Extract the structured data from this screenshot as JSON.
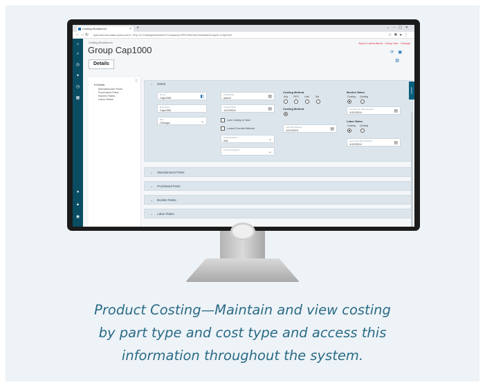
{
  "browser": {
    "tab_title": "Costing Workbench",
    "url": "epicorsb.test.saas.epicor.com/.../Erp.UI.CostingWorkbench?Company=EPIC06&Tab=Details&GroupID=Cap1000"
  },
  "app": {
    "breadcrumb": "Costing Workbench",
    "title": "Group Cap1000",
    "alert": "Epicor Latest Alerts · Group Info · Change",
    "details_button": "Details",
    "side_tab": "Actions"
  },
  "tree": {
    "root": "Details",
    "items": [
      "Manufactured Parts",
      "Purchased Parts",
      "Burden Rates",
      "Labor Rates"
    ]
  },
  "detail": {
    "header": "Detail",
    "group": {
      "label": "Group",
      "value": "Cap1000"
    },
    "description": {
      "label": "Description",
      "value": "Cap1000"
    },
    "site": {
      "label": "Site",
      "value": "Chicago"
    },
    "created_by": {
      "label": "Created By",
      "value": "epicor"
    },
    "created_date": {
      "label": "Created Date",
      "value": "1/12/2024"
    },
    "costing_method_title": "Costing Method",
    "costing_methods": [
      "Avg",
      "FIFO",
      "Last",
      "Std"
    ],
    "costing_method2_title": "Costing Method",
    "check_allow_settings": "Lock Costing on Save",
    "check_allow_override": "Locked Override Methods",
    "default_method": {
      "label": "Default Method",
      "value": "Std"
    },
    "last_method": {
      "label": "Last Part Refresh",
      "value": "1/12/2024"
    },
    "burden_title": "Burden Rates",
    "burden_options": [
      "Costing",
      "Quoting"
    ],
    "burden_date": {
      "label": "Last Burden Rate Refresh",
      "value": "1/12/2024"
    },
    "labor_title": "Labor Rates",
    "labor_options": [
      "Costing",
      "Quoting"
    ],
    "labor_date": {
      "label": "Last Labor Rate Refresh",
      "value": "1/12/2024"
    }
  },
  "sections": [
    "Manufactured Parts",
    "Purchased Parts",
    "Burden Rates",
    "Labor Rates"
  ],
  "caption": [
    "Product Costing—Maintain and view costing",
    "by part type and cost type and access this",
    "information throughout the system."
  ]
}
